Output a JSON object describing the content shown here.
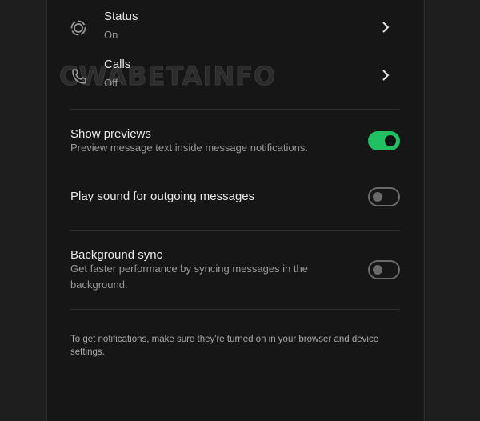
{
  "watermark": "CWABETAINFO",
  "notification_rows": [
    {
      "title": "Status",
      "value": "On",
      "icon": "status-icon"
    },
    {
      "title": "Calls",
      "value": "Off",
      "icon": "phone-icon"
    }
  ],
  "settings": {
    "show_previews": {
      "title": "Show previews",
      "description": "Preview message text inside message notifications.",
      "enabled": true
    },
    "play_sound": {
      "title": "Play sound for outgoing messages",
      "enabled": false
    },
    "background_sync": {
      "title": "Background sync",
      "description_line1": "Get faster performance by syncing messages in the",
      "description_line2": "background.",
      "enabled": false
    }
  },
  "footer_line1": "To get notifications, make sure they're turned on in your browser and device",
  "footer_line2": "settings.",
  "colors": {
    "toggle_on": "#21c063",
    "background": "#161616"
  }
}
